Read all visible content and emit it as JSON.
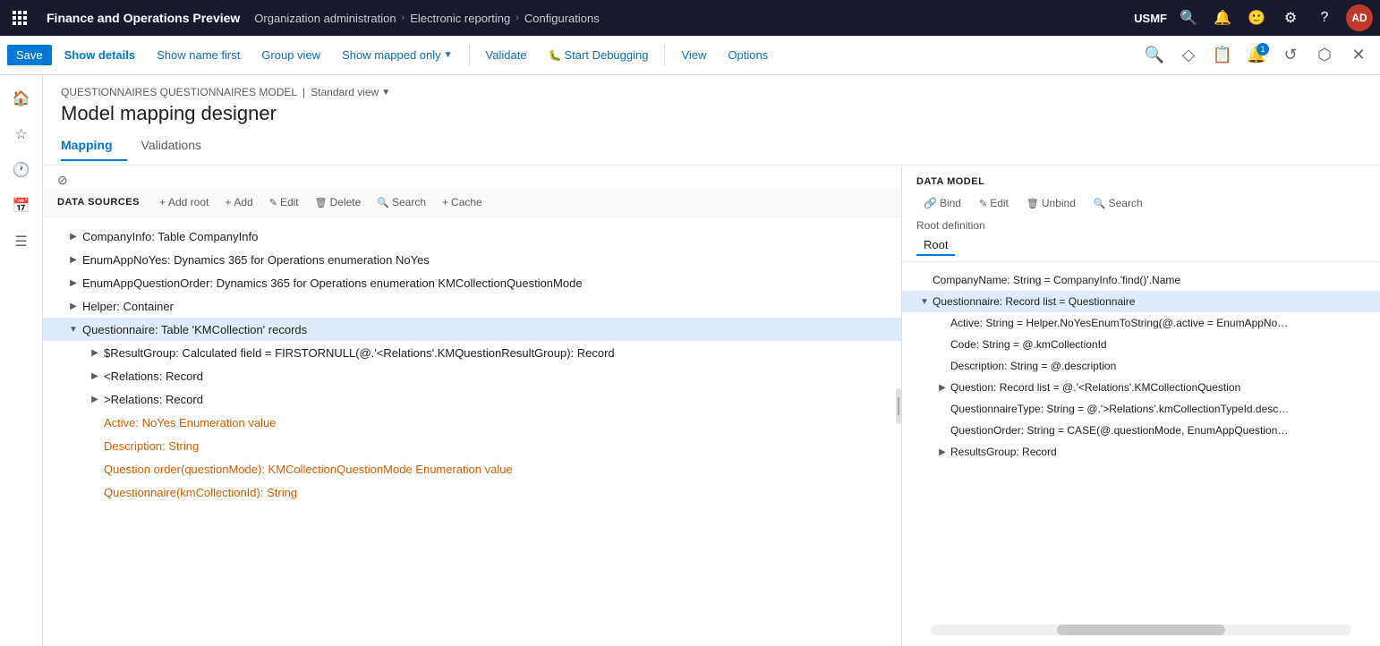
{
  "topNav": {
    "appTitle": "Finance and Operations Preview",
    "breadcrumb": [
      "Organization administration",
      "Electronic reporting",
      "Configurations"
    ],
    "userCode": "USMF",
    "avatarText": "AD"
  },
  "toolbar": {
    "saveLabel": "Save",
    "showDetailsLabel": "Show details",
    "showNameFirstLabel": "Show name first",
    "groupViewLabel": "Group view",
    "showMappedOnlyLabel": "Show mapped only",
    "validateLabel": "Validate",
    "startDebuggingLabel": "Start Debugging",
    "viewLabel": "View",
    "optionsLabel": "Options"
  },
  "breadcrumbBar": {
    "part1": "QUESTIONNAIRES QUESTIONNAIRES MODEL",
    "separator": "|",
    "part2": "Standard view"
  },
  "pageTitle": "Model mapping designer",
  "tabs": [
    {
      "label": "Mapping",
      "active": true
    },
    {
      "label": "Validations",
      "active": false
    }
  ],
  "leftPane": {
    "title": "DATA SOURCES",
    "actions": [
      {
        "label": "Add root",
        "icon": "+"
      },
      {
        "label": "Add",
        "icon": "+"
      },
      {
        "label": "Edit",
        "icon": "✎"
      },
      {
        "label": "Delete",
        "icon": "🗑"
      },
      {
        "label": "Search",
        "icon": "🔍"
      },
      {
        "label": "Cache",
        "icon": "+"
      }
    ],
    "items": [
      {
        "label": "CompanyInfo: Table CompanyInfo",
        "indent": 1,
        "expandable": true,
        "expanded": false,
        "style": "normal"
      },
      {
        "label": "EnumAppNoYes: Dynamics 365 for Operations enumeration NoYes",
        "indent": 1,
        "expandable": true,
        "expanded": false,
        "style": "normal"
      },
      {
        "label": "EnumAppQuestionOrder: Dynamics 365 for Operations enumeration KMCollectionQuestionMode",
        "indent": 1,
        "expandable": true,
        "expanded": false,
        "style": "normal"
      },
      {
        "label": "Helper: Container",
        "indent": 1,
        "expandable": true,
        "expanded": false,
        "style": "normal"
      },
      {
        "label": "Questionnaire: Table 'KMCollection' records",
        "indent": 1,
        "expandable": true,
        "expanded": true,
        "style": "selected"
      },
      {
        "label": "$ResultGroup: Calculated field = FIRSTORNULL(@.'<Relations'.KMQuestionResultGroup): Record",
        "indent": 2,
        "expandable": true,
        "expanded": false,
        "style": "normal"
      },
      {
        "label": "<Relations: Record",
        "indent": 2,
        "expandable": true,
        "expanded": false,
        "style": "normal"
      },
      {
        "label": ">Relations: Record",
        "indent": 2,
        "expandable": true,
        "expanded": false,
        "style": "normal"
      },
      {
        "label": "Active: NoYes Enumeration value",
        "indent": 2,
        "expandable": false,
        "expanded": false,
        "style": "orange"
      },
      {
        "label": "Description: String",
        "indent": 2,
        "expandable": false,
        "expanded": false,
        "style": "orange"
      },
      {
        "label": "Question order(questionMode): KMCollectionQuestionMode Enumeration value",
        "indent": 2,
        "expandable": false,
        "expanded": false,
        "style": "orange"
      },
      {
        "label": "Questionnaire(kmCollectionId): String",
        "indent": 2,
        "expandable": false,
        "expanded": false,
        "style": "orange"
      }
    ]
  },
  "rightPane": {
    "title": "DATA MODEL",
    "actions": [
      {
        "label": "Bind",
        "icon": "🔗"
      },
      {
        "label": "Edit",
        "icon": "✎"
      },
      {
        "label": "Unbind",
        "icon": "🗑"
      },
      {
        "label": "Search",
        "icon": "🔍"
      }
    ],
    "rootDefinitionLabel": "Root definition",
    "rootValue": "Root",
    "items": [
      {
        "label": "CompanyName: String = CompanyInfo.'find()'.Name",
        "indent": 0,
        "expandable": false,
        "style": "normal"
      },
      {
        "label": "Questionnaire: Record list = Questionnaire",
        "indent": 0,
        "expandable": true,
        "expanded": true,
        "style": "selected"
      },
      {
        "label": "Active: String = Helper.NoYesEnumToString(@.active = EnumAppNo…",
        "indent": 1,
        "expandable": false,
        "style": "normal"
      },
      {
        "label": "Code: String = @.kmCollectionId",
        "indent": 1,
        "expandable": false,
        "style": "normal"
      },
      {
        "label": "Description: String = @.description",
        "indent": 1,
        "expandable": false,
        "style": "normal"
      },
      {
        "label": "Question: Record list = @.'<Relations'.KMCollectionQuestion",
        "indent": 1,
        "expandable": true,
        "expanded": false,
        "style": "normal"
      },
      {
        "label": "QuestionnaireType: String = @.'>Relations'.kmCollectionTypeId.desc…",
        "indent": 1,
        "expandable": false,
        "style": "normal"
      },
      {
        "label": "QuestionOrder: String = CASE(@.questionMode, EnumAppQuestion…",
        "indent": 1,
        "expandable": false,
        "style": "normal"
      },
      {
        "label": "ResultsGroup: Record",
        "indent": 1,
        "expandable": true,
        "expanded": false,
        "style": "normal"
      }
    ]
  }
}
